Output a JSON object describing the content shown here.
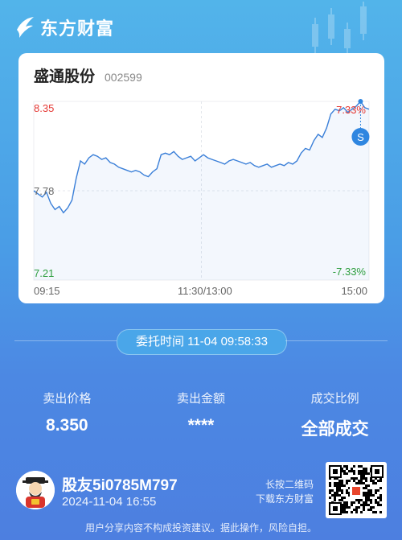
{
  "brand": {
    "name": "东方财富"
  },
  "stock": {
    "name": "盛通股份",
    "code": "002599"
  },
  "chart_data": {
    "type": "line",
    "y_labels": {
      "high": "8.35",
      "mid": "7.78",
      "low": "7.21"
    },
    "pct_labels": {
      "high": "7.33%",
      "low": "-7.33%"
    },
    "x_labels": [
      "09:15",
      "11:30/13:00",
      "15:00"
    ],
    "ylim": [
      7.21,
      8.35
    ],
    "sell_marker": "S",
    "series": [
      {
        "values": [
          7.78,
          7.76,
          7.74,
          7.77,
          7.7,
          7.66,
          7.68,
          7.64,
          7.67,
          7.72,
          7.86,
          7.97,
          7.95,
          7.99,
          8.01,
          8.0,
          7.98,
          7.99,
          7.96,
          7.95,
          7.93,
          7.92,
          7.91,
          7.9,
          7.91,
          7.9,
          7.88,
          7.87,
          7.9,
          7.92,
          8.01,
          8.02,
          8.01,
          8.03,
          8.0,
          7.98,
          7.99,
          8.0,
          7.97,
          7.99,
          8.01,
          7.99,
          7.98,
          7.97,
          7.96,
          7.95,
          7.97,
          7.98,
          7.97,
          7.96,
          7.95,
          7.96,
          7.94,
          7.93,
          7.94,
          7.95,
          7.93,
          7.94,
          7.95,
          7.94,
          7.96,
          7.95,
          7.97,
          8.02,
          8.05,
          8.04,
          8.1,
          8.14,
          8.12,
          8.18,
          8.27,
          8.3,
          8.29,
          8.31,
          8.28,
          8.3,
          8.32,
          8.35,
          8.31,
          8.3
        ]
      }
    ]
  },
  "order_time": "委托时间 11-04 09:58:33",
  "stats": [
    {
      "label": "卖出价格",
      "value": "8.350"
    },
    {
      "label": "卖出金额",
      "value": "****"
    },
    {
      "label": "成交比例",
      "value": "全部成交"
    }
  ],
  "user": {
    "name": "股友5i0785M797",
    "share_date": "2024-11-04 16:55"
  },
  "qr_hint": {
    "line1": "长按二维码",
    "line2": "下载东方财富"
  },
  "disclaimer": "用户分享内容不构成投资建议。据此操作，风险自担。",
  "colors": {
    "up": "#e53935",
    "down": "#2e9e3e",
    "line": "#3a7fd8",
    "marker": "#2f86e0"
  }
}
